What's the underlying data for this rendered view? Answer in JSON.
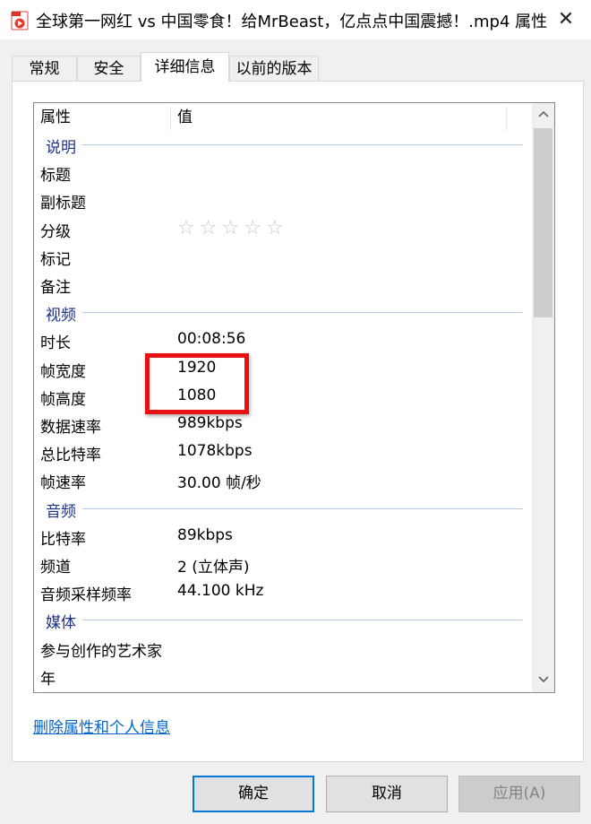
{
  "window": {
    "title": "全球第一网红 vs 中国零食！给MrBeast，亿点点中国震撼！.mp4 属性",
    "close_glyph": "✕"
  },
  "tabs": [
    {
      "label": "常规"
    },
    {
      "label": "安全"
    },
    {
      "label": "详细信息"
    },
    {
      "label": "以前的版本"
    }
  ],
  "list": {
    "col_property": "属性",
    "col_value": "值",
    "rows": [
      {
        "type": "group",
        "label": "说明"
      },
      {
        "type": "item",
        "label": "标题",
        "value": ""
      },
      {
        "type": "item",
        "label": "副标题",
        "value": ""
      },
      {
        "type": "rating",
        "label": "分级",
        "stars": 0,
        "max": 5
      },
      {
        "type": "item",
        "label": "标记",
        "value": ""
      },
      {
        "type": "item",
        "label": "备注",
        "value": ""
      },
      {
        "type": "group",
        "label": "视频"
      },
      {
        "type": "item",
        "label": "时长",
        "value": "00:08:56"
      },
      {
        "type": "item",
        "label": "帧宽度",
        "value": "1920"
      },
      {
        "type": "item",
        "label": "帧高度",
        "value": "1080"
      },
      {
        "type": "item",
        "label": "数据速率",
        "value": "989kbps"
      },
      {
        "type": "item",
        "label": "总比特率",
        "value": "1078kbps"
      },
      {
        "type": "item",
        "label": "帧速率",
        "value": "30.00 帧/秒"
      },
      {
        "type": "group",
        "label": "音频"
      },
      {
        "type": "item",
        "label": "比特率",
        "value": "89kbps"
      },
      {
        "type": "item",
        "label": "频道",
        "value": "2 (立体声)"
      },
      {
        "type": "item",
        "label": "音频采样频率",
        "value": "44.100 kHz"
      },
      {
        "type": "group",
        "label": "媒体"
      },
      {
        "type": "item",
        "label": "参与创作的艺术家",
        "value": ""
      },
      {
        "type": "item",
        "label": "年",
        "value": ""
      }
    ]
  },
  "remove_link": "删除属性和个人信息",
  "buttons": {
    "ok": "确定",
    "cancel": "取消",
    "apply": "应用(A)"
  },
  "colors": {
    "highlight": "#e81010",
    "group_text": "#1e3287",
    "link": "#0066cc"
  }
}
